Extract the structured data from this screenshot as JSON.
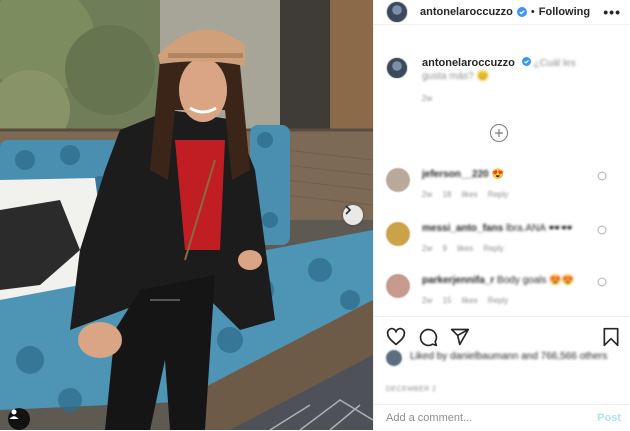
{
  "post": {
    "author": "antonelaroccuzzo",
    "separator": "•",
    "follow_status": "Following",
    "more_label": "•••",
    "next_label": "›"
  },
  "caption": {
    "username": "antonelaroccuzzo",
    "text": "¿Cuál les gusta más? 😊",
    "time": "2w"
  },
  "comments": [
    {
      "username": "jeferson__220",
      "text": "😍",
      "meta": "2w 18 likes Reply",
      "avatar_color": "#b9a99b"
    },
    {
      "username": "messi_anto_fans",
      "text": "lbra.ANA 🕶️🕶️",
      "meta": "2w 9 likes Reply",
      "avatar_color": "#c9a24a"
    },
    {
      "username": "parkerjennifa_r",
      "text": "Body goals 😍😍",
      "meta": "2w 15 likes Reply",
      "avatar_color": "#c69a8c"
    }
  ],
  "likes": {
    "text": "Liked by danielbaumann and 766,566 others"
  },
  "date": "DECEMBER 2",
  "add_comment": {
    "placeholder": "Add a comment...",
    "post_label": "Post"
  },
  "icons": [
    "verified-badge-icon",
    "more-icon",
    "load-more-icon",
    "heart-icon",
    "comment-icon",
    "share-icon",
    "save-icon",
    "tag-user-icon",
    "chevron-right-icon"
  ],
  "colors": {
    "verified": "#3897f0",
    "post_disabled": "#b2dffc",
    "muted": "#8e8e8e"
  }
}
